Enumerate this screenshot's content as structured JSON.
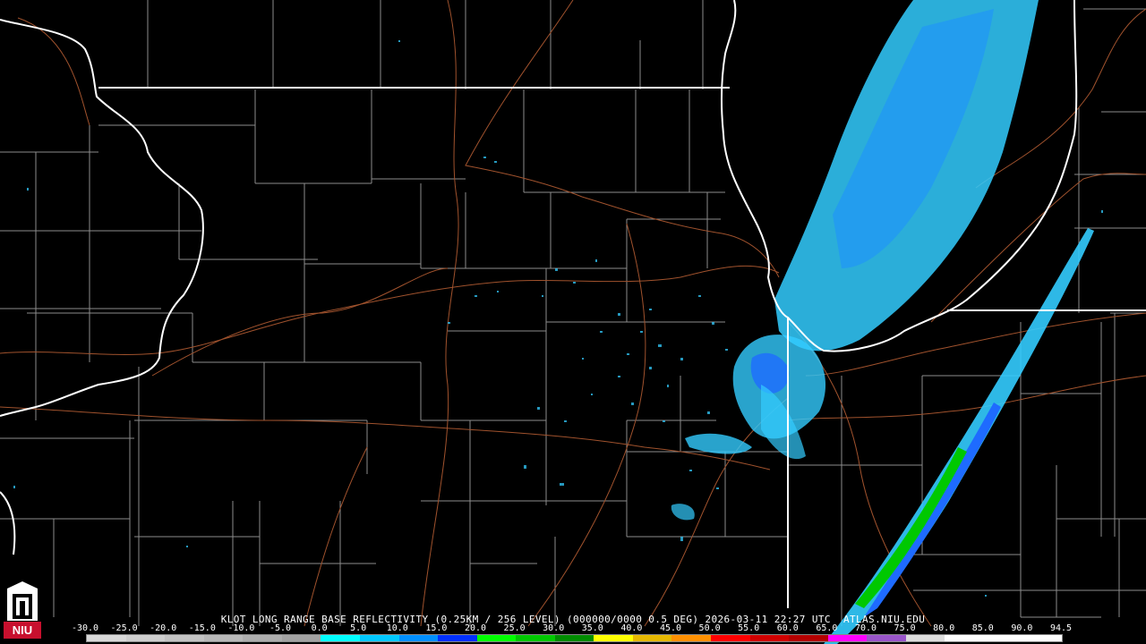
{
  "product": {
    "title": "KLOT LONG RANGE BASE REFLECTIVITY (0.25KM / 256 LEVEL) (000000/0000 0.5 DEG) 2026-03-11 22:27 UTC  ATLAS.NIU.EDU"
  },
  "scale": {
    "ticks": [
      "-30.0",
      "-25.0",
      "-20.0",
      "-15.0",
      "-10.0",
      "-5.0",
      "0.0",
      "5.0",
      "10.0",
      "15.0",
      "20.0",
      "25.0",
      "30.0",
      "35.0",
      "40.0",
      "45.0",
      "50.0",
      "55.0",
      "60.0",
      "65.0",
      "70.0",
      "75.0",
      "80.0",
      "85.0",
      "90.0",
      "94.5"
    ],
    "colors": [
      "#d9d9d9",
      "#cfcfcf",
      "#c4c4c4",
      "#b9b9b9",
      "#aeaeae",
      "#a3a3a3",
      "#00ffff",
      "#00c8ff",
      "#0090ff",
      "#0030ff",
      "#00ff00",
      "#00c800",
      "#008c00",
      "#ffff00",
      "#e6b800",
      "#ff9000",
      "#ff0000",
      "#d00000",
      "#b40000",
      "#ff00ff",
      "#9955c9",
      "#dddddd",
      "#ffffff",
      "#ffffff",
      "#ffffff"
    ]
  },
  "map_colors": {
    "background": "#000000",
    "state_border": "#ffffff",
    "county_border": "#8c8c8c",
    "highway": "#a0522d",
    "echo_light": "#33ccff",
    "echo_medium": "#1e6bff",
    "echo_strong": "#00c800"
  },
  "logo": {
    "text": "NIU",
    "color": "#c8102e"
  }
}
